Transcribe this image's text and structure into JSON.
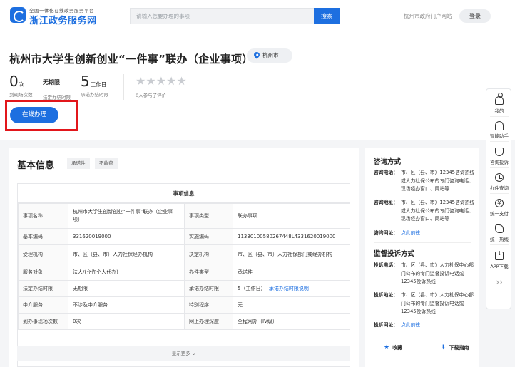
{
  "header": {
    "brand_sub": "全国一体化在线政务服务平台",
    "brand_main": "浙江政务服务网",
    "search_placeholder": "请输入您要办理的事项",
    "search_button": "搜索",
    "portal_link": "杭州市政府门户网站",
    "login_button": "登录"
  },
  "hero": {
    "title": "杭州市大学生创新创业“一件事”联办（企业事项）",
    "location": "杭州市",
    "stats": [
      {
        "value": "0",
        "unit": "次",
        "caption": "到现场次数"
      },
      {
        "value": "无期限",
        "unit": "",
        "caption": "法定办结时限"
      },
      {
        "value": "5",
        "unit": "工作日",
        "caption": "承诺办结时限"
      }
    ],
    "rating": {
      "stars": 0,
      "max": 5,
      "caption": "0人参与了评价"
    },
    "online_button": "在线办理"
  },
  "sidebar_float": [
    {
      "label": "我的",
      "icon": "user-icon"
    },
    {
      "label": "智能助手",
      "icon": "headset-icon"
    },
    {
      "label": "咨询投诉",
      "icon": "shield-icon"
    },
    {
      "label": "办件查询",
      "icon": "clock-icon"
    },
    {
      "label": "统一支付",
      "icon": "yen-icon"
    },
    {
      "label": "统一热线",
      "icon": "phone-icon"
    },
    {
      "label": "APP下载",
      "icon": "download-icon"
    }
  ],
  "basic": {
    "title": "基本信息",
    "chips": [
      "承诺件",
      "不收费"
    ],
    "panel_title": "事项信息",
    "rows": [
      [
        "事项名称",
        "杭州市大学生创新创业“一件事”联办（企业事项）",
        "事项类型",
        "联办事项"
      ],
      [
        "基本编码",
        "331620019000",
        "实施编码",
        "11330100580267448L4331620019000"
      ],
      [
        "受理机构",
        "市、区（县、市）人力社保经办机构",
        "决定机构",
        "市、区（县、市）人力社保部门或经办机构"
      ],
      [
        "服务对象",
        "法人/(允许个人代办)",
        "办件类型",
        "承诺件"
      ],
      [
        "法定办结时限",
        "无期限",
        "承诺办结时限",
        "5（工作日）"
      ],
      [
        "中介服务",
        "不涉及中介服务",
        "特别程序",
        "无"
      ],
      [
        "到办事现场次数",
        "0次",
        "网上办理深度",
        "全程网办（IV级）"
      ]
    ],
    "deadline_link": "承诺办结时限说明",
    "more": "显示更多"
  },
  "side": {
    "consult_title": "咨询方式",
    "consult": [
      {
        "key": "咨询电话：",
        "value": "市、区（县、市）12345咨询热线或人力社保公布的专门咨询电话、现场经办窗口、网站等"
      },
      {
        "key": "咨询地址：",
        "value": "市、区（县、市）12345咨询热线或人力社保公布的专门咨询电话、现场经办窗口、网站等"
      },
      {
        "key": "咨询网址：",
        "value": "点此前往"
      }
    ],
    "complaint_title": "监督投诉方式",
    "complaint": [
      {
        "key": "投诉电话：",
        "value": "市、区（县、市）人力社保中心部门公布的专门监督投诉电话或12345投诉热线"
      },
      {
        "key": "投诉地址：",
        "value": "市、区（县、市）人力社保中心部门公布的专门监督投诉电话或12345投诉热线"
      },
      {
        "key": "投诉网址：",
        "value": "点此前往"
      }
    ],
    "favorite": "收藏",
    "download_guide": "下载指南"
  }
}
